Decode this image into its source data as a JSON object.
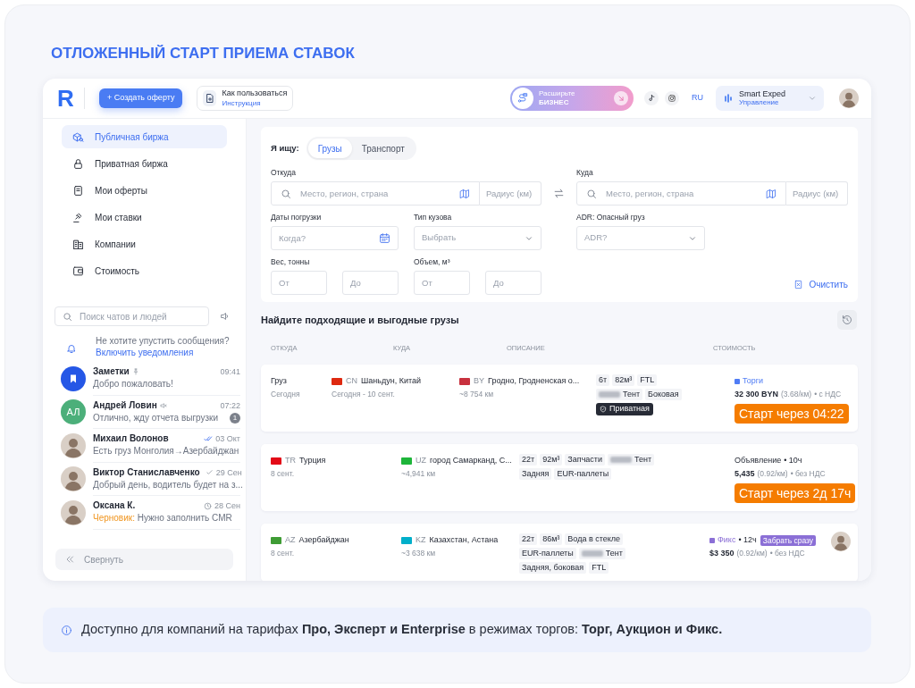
{
  "heading": "ОТЛОЖЕННЫЙ СТАРТ ПРИЕМА СТАВОК",
  "topbar": {
    "logo": "R",
    "create_button": "+ Создать оферту",
    "help": {
      "title": "Как пользоваться",
      "link": "Инструкция"
    },
    "promo": {
      "title": "Расширьте",
      "subtitle": "БИЗНЕС"
    },
    "language": "RU",
    "account": {
      "name": "Smart Exped",
      "role": "Управление"
    }
  },
  "sidebar": {
    "nav": [
      {
        "label": "Публичная биржа",
        "selected": true
      },
      {
        "label": "Приватная биржа",
        "selected": false
      },
      {
        "label": "Мои оферты",
        "selected": false
      },
      {
        "label": "Мои ставки",
        "selected": false
      },
      {
        "label": "Компании",
        "selected": false
      },
      {
        "label": "Стоимость",
        "selected": false
      }
    ],
    "chat_search": {
      "placeholder": "Поиск чатов и людей"
    },
    "notice": {
      "text": "Не хотите упустить сообщения?",
      "link": "Включить уведомления"
    },
    "chats": [
      {
        "name": "Заметки",
        "kind": "notes",
        "pinned": true,
        "muted": false,
        "read": false,
        "sent": false,
        "scheduled": false,
        "time": "09:41",
        "preview": "Добро пожаловать!"
      },
      {
        "name": "Андрей Ловин",
        "kind": "initials",
        "initials": "АЛ",
        "color": "#4caf7a",
        "pinned": false,
        "muted": true,
        "read": false,
        "sent": false,
        "scheduled": false,
        "time": "07:22",
        "preview": "Отлично, жду отчета выгрузки",
        "unread": "1"
      },
      {
        "name": "Михаил Волонов",
        "kind": "photo",
        "pinned": false,
        "muted": false,
        "read": true,
        "sent": false,
        "scheduled": false,
        "time": "03 Окт",
        "preview": "Есть груз Монголия→Азербайджан"
      },
      {
        "name": "Виктор Станиславченко",
        "kind": "photo",
        "pinned": false,
        "muted": false,
        "read": false,
        "sent": true,
        "scheduled": false,
        "time": "29 Сен",
        "preview": "Добрый день, водитель будет на з..."
      },
      {
        "name": "Оксана К.",
        "kind": "photo",
        "pinned": false,
        "muted": false,
        "read": false,
        "sent": false,
        "scheduled": true,
        "time": "28 Сен",
        "draft_label": "Черновик:",
        "preview": "Нужно заполнить CMR"
      }
    ],
    "collapse": "Свернуть"
  },
  "search_form": {
    "looking_for": {
      "label": "Я ищу:",
      "tabs": [
        {
          "label": "Грузы",
          "selected": true
        },
        {
          "label": "Транспорт",
          "selected": false
        }
      ]
    },
    "from": {
      "label": "Откуда",
      "placeholder": "Место, регион, страна",
      "radius_placeholder": "Радиус (км)"
    },
    "to": {
      "label": "Куда",
      "placeholder": "Место, регион, страна",
      "radius_placeholder": "Радиус (км)"
    },
    "dates": {
      "label": "Даты погрузки",
      "placeholder": "Когда?"
    },
    "body_type": {
      "label": "Тип кузова",
      "placeholder": "Выбрать"
    },
    "adr": {
      "label": "ADR: Опасный груз",
      "placeholder": "ADR?"
    },
    "weight": {
      "label": "Вес, тонны",
      "from_placeholder": "От",
      "to_placeholder": "До"
    },
    "volume": {
      "label": "Объем, м³",
      "from_placeholder": "От",
      "to_placeholder": "До"
    },
    "clear": "Очистить"
  },
  "results": {
    "title": "Найдите подходящие и выгодные грузы",
    "columns": [
      "ОТКУДА",
      "КУДА",
      "ОПИСАНИЕ",
      "СТОИМОСТЬ"
    ],
    "rows": [
      {
        "cargo": {
          "label": "Груз",
          "date": "Сегодня"
        },
        "origin": {
          "code": "CN",
          "color": "#de2910",
          "place": "Шаньдун, Китай",
          "sub": "Сегодня - 10 сент."
        },
        "destination": {
          "code": "BY",
          "color": "#c8313e",
          "place": "Гродно, Гродненская о...",
          "sub": "~8 754 км"
        },
        "tag_lines": [
          [
            {
              "kind": "plain",
              "text": "6т"
            },
            {
              "kind": "plain",
              "text": "82м³"
            },
            {
              "kind": "plain",
              "text": "FTL"
            }
          ],
          [
            {
              "kind": "vehicle",
              "text": "Тент"
            },
            {
              "kind": "plain",
              "text": "Боковая"
            }
          ]
        ],
        "badge": "Приватная",
        "price": {
          "mode": "Торги",
          "color": "#4f7cf5",
          "amount": "32 300 BYN",
          "rate": "(3.68/км)",
          "vat": "• с НДС"
        },
        "countdown": "Старт через 04:22",
        "contact": false
      },
      {
        "origin": {
          "code": "TR",
          "color": "#e30a17",
          "place": "Турция",
          "sub": "8 сент."
        },
        "destination": {
          "code": "UZ",
          "color": "#1eb53a",
          "place": "город Самарканд, С...",
          "sub": "~4,941 км"
        },
        "tag_lines": [
          [
            {
              "kind": "plain",
              "text": "22т"
            },
            {
              "kind": "plain",
              "text": "92м³"
            },
            {
              "kind": "plain",
              "text": "Запчасти"
            },
            {
              "kind": "vehicle",
              "text": "Тент"
            }
          ],
          [
            {
              "kind": "plain",
              "text": "Задняя"
            },
            {
              "kind": "plain",
              "text": "EUR-паллеты"
            }
          ]
        ],
        "price": {
          "mode": "Объявление",
          "age": "• 10ч",
          "amount": "5,435",
          "rate": "(0.92/км)",
          "vat": "• без НДС"
        },
        "countdown": "Старт через 2д 17ч",
        "contact": false
      },
      {
        "origin": {
          "code": "AZ",
          "color": "#3f9c35",
          "place": "Азербайджан",
          "sub": "8 сент."
        },
        "destination": {
          "code": "KZ",
          "color": "#00afca",
          "place": "Казахстан, Астана",
          "sub": "~3 638 км"
        },
        "tag_lines": [
          [
            {
              "kind": "plain",
              "text": "22т"
            },
            {
              "kind": "plain",
              "text": "86м³"
            },
            {
              "kind": "plain",
              "text": "Вода в стекле"
            }
          ],
          [
            {
              "kind": "plain",
              "text": "EUR-паллеты"
            },
            {
              "kind": "vehicle",
              "text": "Тент"
            }
          ],
          [
            {
              "kind": "plain",
              "text": "Задняя, боковая"
            },
            {
              "kind": "plain",
              "text": "FTL"
            }
          ]
        ],
        "price": {
          "mode": "Фикс",
          "color": "#8b6fd6",
          "age": "• 12ч",
          "action": "Забрать сразу",
          "amount": "$3 350",
          "rate": "(0.92/км)",
          "vat": "• без НДС"
        },
        "contact": true
      }
    ]
  },
  "footer_note": "Доступно для компаний на тарифах **Про, Эксперт и Enterprise** в режимах торгов: **Торг, Аукцион и Фикс.**"
}
